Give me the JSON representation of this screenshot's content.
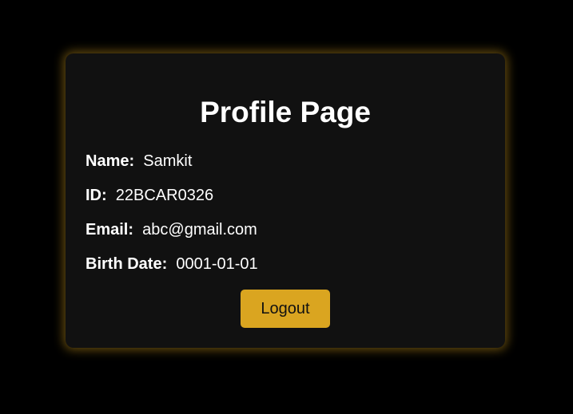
{
  "profile": {
    "title": "Profile Page",
    "fields": [
      {
        "label": "Name:",
        "value": "Samkit"
      },
      {
        "label": "ID:",
        "value": "22BCAR0326"
      },
      {
        "label": "Email:",
        "value": "abc@gmail.com"
      },
      {
        "label": "Birth Date:",
        "value": "0001-01-01"
      }
    ],
    "logout_label": "Logout"
  },
  "colors": {
    "background": "#000000",
    "card": "#111111",
    "accent": "#DAA520",
    "text": "#FFFFFF"
  }
}
